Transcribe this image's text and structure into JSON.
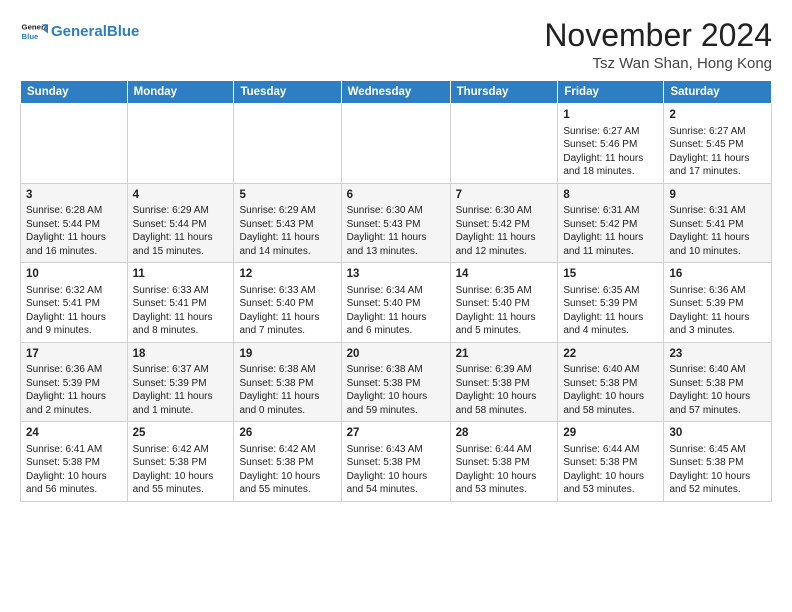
{
  "header": {
    "logo_text_general": "General",
    "logo_text_blue": "Blue",
    "title": "November 2024",
    "subtitle": "Tsz Wan Shan, Hong Kong"
  },
  "days_of_week": [
    "Sunday",
    "Monday",
    "Tuesday",
    "Wednesday",
    "Thursday",
    "Friday",
    "Saturday"
  ],
  "weeks": [
    [
      {
        "day": "",
        "info": ""
      },
      {
        "day": "",
        "info": ""
      },
      {
        "day": "",
        "info": ""
      },
      {
        "day": "",
        "info": ""
      },
      {
        "day": "",
        "info": ""
      },
      {
        "day": "1",
        "info": "Sunrise: 6:27 AM\nSunset: 5:46 PM\nDaylight: 11 hours and 18 minutes."
      },
      {
        "day": "2",
        "info": "Sunrise: 6:27 AM\nSunset: 5:45 PM\nDaylight: 11 hours and 17 minutes."
      }
    ],
    [
      {
        "day": "3",
        "info": "Sunrise: 6:28 AM\nSunset: 5:44 PM\nDaylight: 11 hours and 16 minutes."
      },
      {
        "day": "4",
        "info": "Sunrise: 6:29 AM\nSunset: 5:44 PM\nDaylight: 11 hours and 15 minutes."
      },
      {
        "day": "5",
        "info": "Sunrise: 6:29 AM\nSunset: 5:43 PM\nDaylight: 11 hours and 14 minutes."
      },
      {
        "day": "6",
        "info": "Sunrise: 6:30 AM\nSunset: 5:43 PM\nDaylight: 11 hours and 13 minutes."
      },
      {
        "day": "7",
        "info": "Sunrise: 6:30 AM\nSunset: 5:42 PM\nDaylight: 11 hours and 12 minutes."
      },
      {
        "day": "8",
        "info": "Sunrise: 6:31 AM\nSunset: 5:42 PM\nDaylight: 11 hours and 11 minutes."
      },
      {
        "day": "9",
        "info": "Sunrise: 6:31 AM\nSunset: 5:41 PM\nDaylight: 11 hours and 10 minutes."
      }
    ],
    [
      {
        "day": "10",
        "info": "Sunrise: 6:32 AM\nSunset: 5:41 PM\nDaylight: 11 hours and 9 minutes."
      },
      {
        "day": "11",
        "info": "Sunrise: 6:33 AM\nSunset: 5:41 PM\nDaylight: 11 hours and 8 minutes."
      },
      {
        "day": "12",
        "info": "Sunrise: 6:33 AM\nSunset: 5:40 PM\nDaylight: 11 hours and 7 minutes."
      },
      {
        "day": "13",
        "info": "Sunrise: 6:34 AM\nSunset: 5:40 PM\nDaylight: 11 hours and 6 minutes."
      },
      {
        "day": "14",
        "info": "Sunrise: 6:35 AM\nSunset: 5:40 PM\nDaylight: 11 hours and 5 minutes."
      },
      {
        "day": "15",
        "info": "Sunrise: 6:35 AM\nSunset: 5:39 PM\nDaylight: 11 hours and 4 minutes."
      },
      {
        "day": "16",
        "info": "Sunrise: 6:36 AM\nSunset: 5:39 PM\nDaylight: 11 hours and 3 minutes."
      }
    ],
    [
      {
        "day": "17",
        "info": "Sunrise: 6:36 AM\nSunset: 5:39 PM\nDaylight: 11 hours and 2 minutes."
      },
      {
        "day": "18",
        "info": "Sunrise: 6:37 AM\nSunset: 5:39 PM\nDaylight: 11 hours and 1 minute."
      },
      {
        "day": "19",
        "info": "Sunrise: 6:38 AM\nSunset: 5:38 PM\nDaylight: 11 hours and 0 minutes."
      },
      {
        "day": "20",
        "info": "Sunrise: 6:38 AM\nSunset: 5:38 PM\nDaylight: 10 hours and 59 minutes."
      },
      {
        "day": "21",
        "info": "Sunrise: 6:39 AM\nSunset: 5:38 PM\nDaylight: 10 hours and 58 minutes."
      },
      {
        "day": "22",
        "info": "Sunrise: 6:40 AM\nSunset: 5:38 PM\nDaylight: 10 hours and 58 minutes."
      },
      {
        "day": "23",
        "info": "Sunrise: 6:40 AM\nSunset: 5:38 PM\nDaylight: 10 hours and 57 minutes."
      }
    ],
    [
      {
        "day": "24",
        "info": "Sunrise: 6:41 AM\nSunset: 5:38 PM\nDaylight: 10 hours and 56 minutes."
      },
      {
        "day": "25",
        "info": "Sunrise: 6:42 AM\nSunset: 5:38 PM\nDaylight: 10 hours and 55 minutes."
      },
      {
        "day": "26",
        "info": "Sunrise: 6:42 AM\nSunset: 5:38 PM\nDaylight: 10 hours and 55 minutes."
      },
      {
        "day": "27",
        "info": "Sunrise: 6:43 AM\nSunset: 5:38 PM\nDaylight: 10 hours and 54 minutes."
      },
      {
        "day": "28",
        "info": "Sunrise: 6:44 AM\nSunset: 5:38 PM\nDaylight: 10 hours and 53 minutes."
      },
      {
        "day": "29",
        "info": "Sunrise: 6:44 AM\nSunset: 5:38 PM\nDaylight: 10 hours and 53 minutes."
      },
      {
        "day": "30",
        "info": "Sunrise: 6:45 AM\nSunset: 5:38 PM\nDaylight: 10 hours and 52 minutes."
      }
    ]
  ]
}
